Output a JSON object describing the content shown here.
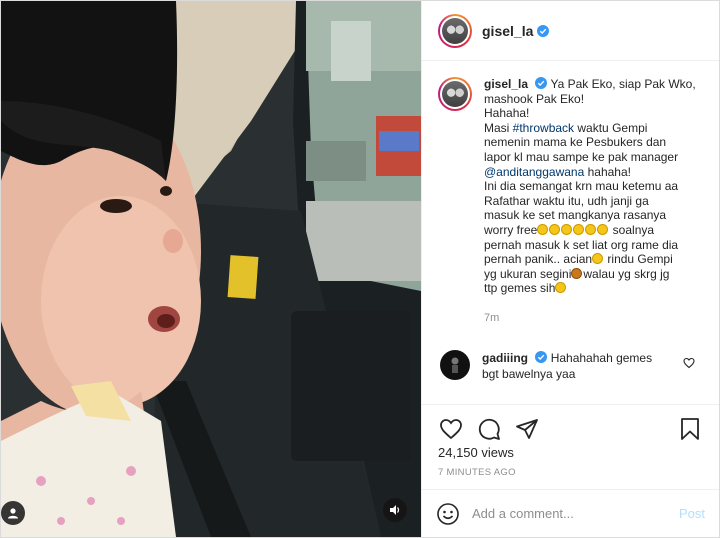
{
  "post": {
    "username": "gisel_la",
    "caption": {
      "username": "gisel_la",
      "l1": "Ya Pak Eko, siap Pak Wko,",
      "l2": "mashook Pak Eko!",
      "l3": "Hahaha!",
      "l4a": "Masi ",
      "hashtag": "#throwback",
      "l4b": " waktu Gempi",
      "l5": "nemenin mama ke Pesbukers dan",
      "l6": "lapor kl mau sampe ke pak manager",
      "mention": "@anditanggawana",
      "l7b": " hahaha!",
      "l8": "Ini dia semangat krn mau ketemu aa",
      "l9": "Rafathar waktu itu, udh janji ga",
      "l10": "masuk ke set mangkanya rasanya",
      "l11a": "worry free",
      "l11b": " soalnya",
      "l12": "pernah masuk k set liat org rame dia",
      "l13a": "pernah panik.. acian",
      "l13b": " rindu Gempi",
      "l14a": "yg ukuran segini",
      "l14b": "walau yg skrg jg",
      "l15": "ttp gemes sih"
    },
    "caption_time": "7m",
    "comment": {
      "username": "gadiiing",
      "text1": "Hahahahah gemes",
      "text2": "bgt bawelnya yaa"
    },
    "views": "24,150 views",
    "posted_time": "7 MINUTES AGO",
    "add_comment_placeholder": "Add a comment...",
    "post_button": "Post"
  },
  "icons": {
    "like": "heart-icon",
    "comment": "comment-icon",
    "share": "paper-plane-icon",
    "save": "bookmark-icon",
    "emoji": "smiley-icon",
    "audio": "speaker-icon",
    "tagged_user": "user-icon"
  },
  "colors": {
    "verified": "#3897f0",
    "link": "#00376b",
    "muted": "#8e8e8e",
    "post_disabled": "#b2dffc"
  }
}
